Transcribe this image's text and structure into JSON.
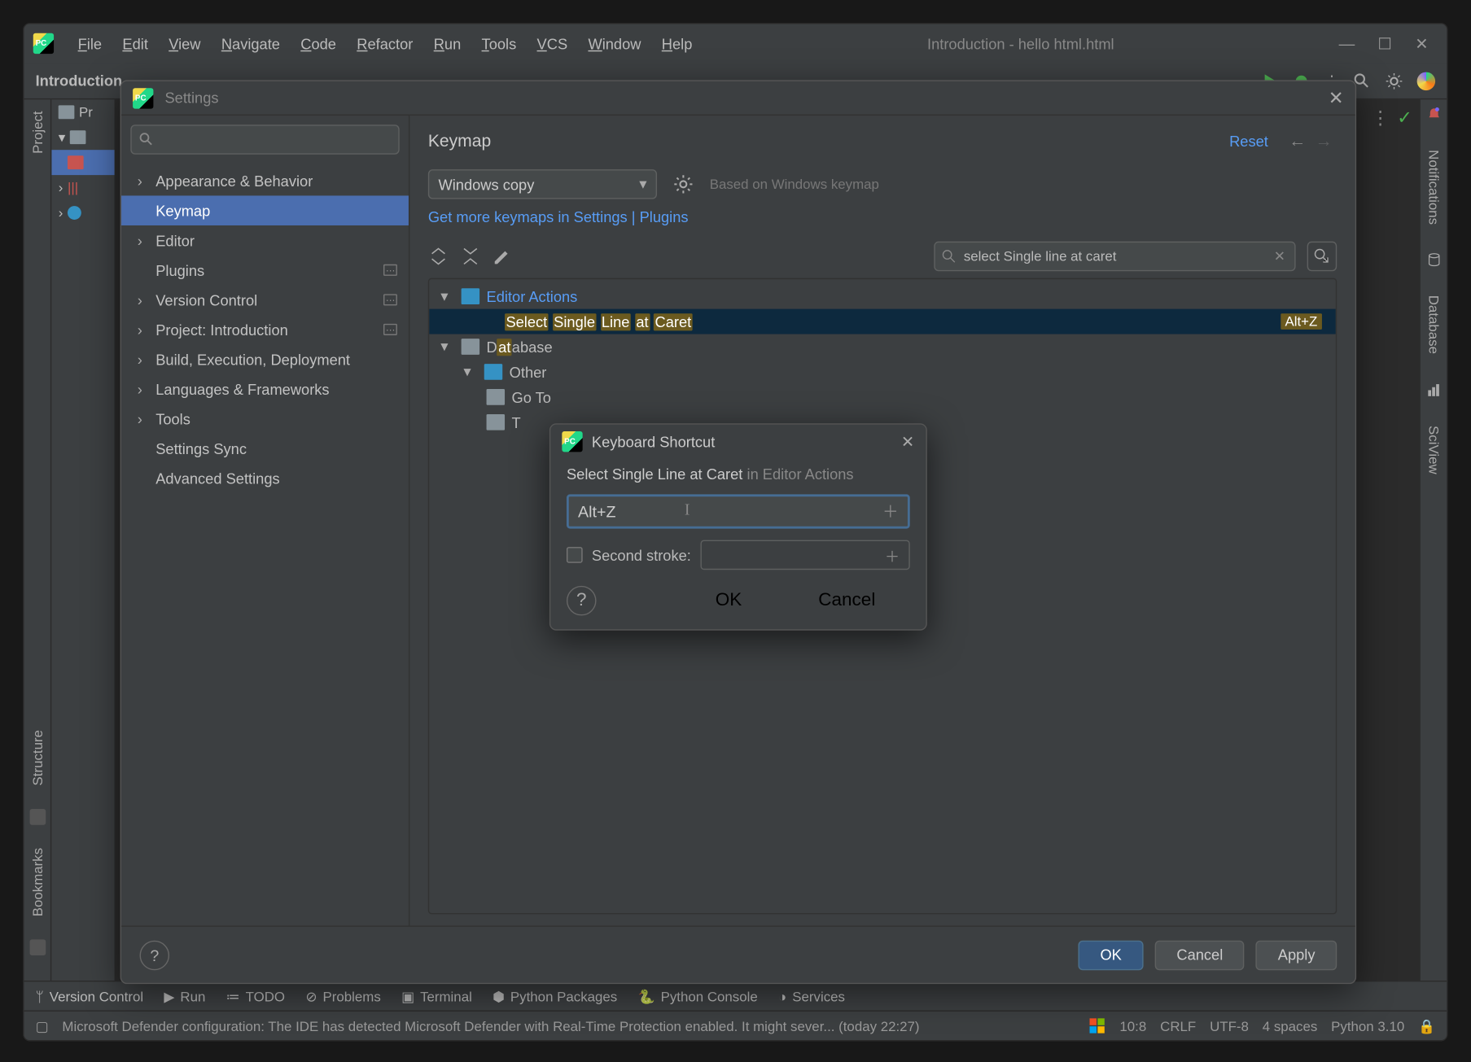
{
  "menubar": [
    "File",
    "Edit",
    "View",
    "Navigate",
    "Code",
    "Refactor",
    "Run",
    "Tools",
    "VCS",
    "Window",
    "Help"
  ],
  "window_title": "Introduction - hello html.html",
  "toolbar": {
    "tab": "Introduction"
  },
  "left_tools": {
    "project": "Project",
    "structure": "Structure",
    "bookmarks": "Bookmarks"
  },
  "project_tree": {
    "root_label": "Pr",
    "items": [
      "",
      "",
      ""
    ]
  },
  "right_tools": {
    "notifications": "Notifications",
    "database": "Database",
    "sciview": "SciView"
  },
  "bottom_tools": {
    "version_control": "Version Control",
    "run": "Run",
    "todo": "TODO",
    "problems": "Problems",
    "terminal": "Terminal",
    "python_packages": "Python Packages",
    "python_console": "Python Console",
    "services": "Services"
  },
  "statusbar": {
    "message": "Microsoft Defender configuration: The IDE has detected Microsoft Defender with Real-Time Protection enabled. It might sever... (today 22:27)",
    "caret": "10:8",
    "line_sep": "CRLF",
    "encoding": "UTF-8",
    "indent": "4 spaces",
    "interpreter": "Python 3.10"
  },
  "settings": {
    "title": "Settings",
    "tree": {
      "appearance": "Appearance & Behavior",
      "keymap": "Keymap",
      "editor": "Editor",
      "plugins": "Plugins",
      "version_control": "Version Control",
      "project": "Project: Introduction",
      "build": "Build, Execution, Deployment",
      "languages": "Languages & Frameworks",
      "tools": "Tools",
      "settings_sync": "Settings Sync",
      "advanced": "Advanced Settings"
    },
    "page": {
      "title": "Keymap",
      "reset": "Reset",
      "keymap_name": "Windows copy",
      "based_on": "Based on Windows keymap",
      "get_more": "Get more keymaps in Settings | Plugins",
      "search_value": "select Single line at caret",
      "tree": {
        "editor_actions": "Editor Actions",
        "select_single_line": [
          "Select",
          "Single",
          "Line",
          "at",
          "Caret"
        ],
        "select_single_line_shortcut": "Alt+Z",
        "database": "Database",
        "other": "Other",
        "goto": "Go To",
        "t_partial": "T"
      }
    },
    "buttons": {
      "ok": "OK",
      "cancel": "Cancel",
      "apply": "Apply"
    }
  },
  "shortcut_dialog": {
    "title": "Keyboard Shortcut",
    "action_name": "Select Single Line at Caret",
    "action_context": "in Editor Actions",
    "first_stroke": "Alt+Z",
    "second_stroke_label": "Second stroke:",
    "ok": "OK",
    "cancel": "Cancel"
  }
}
